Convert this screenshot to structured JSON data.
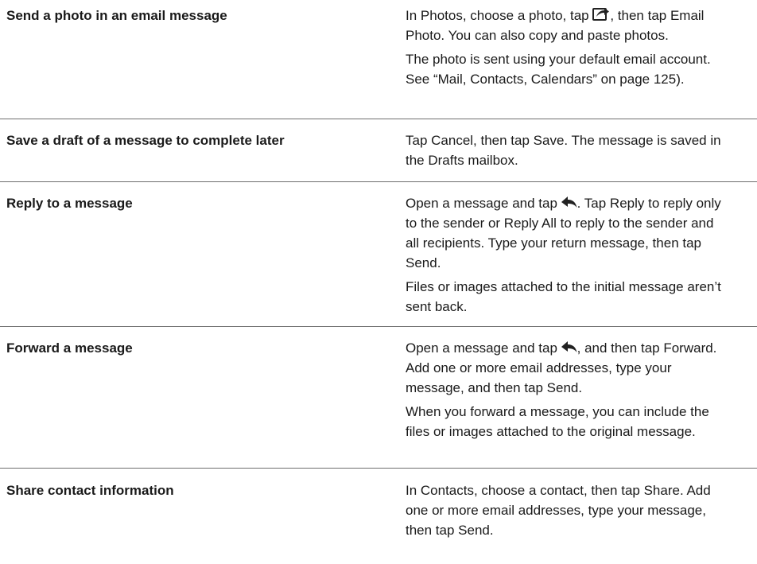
{
  "rows": [
    {
      "task": "Send a photo in an email message",
      "p1_a": "In Photos, choose a photo, tap ",
      "p1_icon": "action-share-icon",
      "p1_b": ", then tap Email Photo. You can also copy and paste photos.",
      "p2": "The photo is sent using your default email account. See “Mail, Contacts, Calendars” on page 125)."
    },
    {
      "task": "Save a draft of a message to complete later",
      "p1": "Tap Cancel, then tap Save. The message is saved in the Drafts mailbox."
    },
    {
      "task": "Reply to a message",
      "p1_a": "Open a message and tap ",
      "p1_icon": "reply-arrow-icon",
      "p1_b": ". Tap Reply to reply only to the sender or Reply All to reply to the sender and all recipients. Type your return message, then tap Send.",
      "p2": "Files or images attached to the initial message aren’t sent back."
    },
    {
      "task": "Forward a message",
      "p1_a": "Open a message and tap ",
      "p1_icon": "reply-arrow-icon",
      "p1_b": ", and then tap Forward. Add one or more email addresses, type your message, and then tap Send.",
      "p2": "When you forward a message, you can include the files or images attached to the original message."
    },
    {
      "task": "Share contact information",
      "p1": "In Contacts, choose a contact, then tap Share. Add one or more email addresses, type your message, then tap Send."
    }
  ]
}
